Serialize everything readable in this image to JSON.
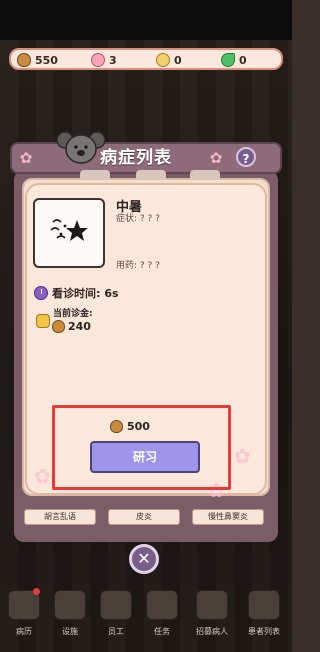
{
  "resources": [
    {
      "icon": "acorn-icon",
      "value": "550"
    },
    {
      "icon": "flower-icon",
      "value": "3"
    },
    {
      "icon": "coin-icon",
      "value": "0"
    },
    {
      "icon": "leaf-icon",
      "value": "0"
    }
  ],
  "panel": {
    "title": "病症列表",
    "help": "?"
  },
  "disease": {
    "name": "中暑",
    "symptom": "症状: ? ? ?",
    "medicine": "用药: ? ? ?",
    "time_label": "看诊时间:",
    "time_value": "6s",
    "fee_label": "当前诊金:",
    "fee_value": "240"
  },
  "research": {
    "cost": "500",
    "button_label": "研习"
  },
  "disease_tabs": [
    "胡言乱语",
    "皮炎",
    "慢性鼻窦炎"
  ],
  "close_label": "✕",
  "bottom_nav": [
    "病历",
    "设施",
    "员工",
    "任务",
    "招募病人",
    "患者列表"
  ],
  "colors": {
    "button_fill": "#9e95ea",
    "highlight": "#e23b3b",
    "panel": "#7b5d68"
  }
}
